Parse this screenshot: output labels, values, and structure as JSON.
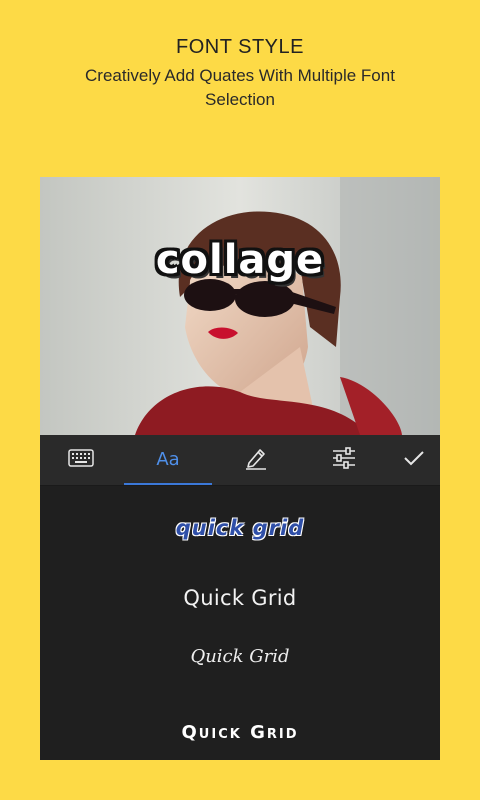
{
  "promo": {
    "title": "FONT STYLE",
    "subtitle": "Creatively Add Quates With Multiple Font Selection"
  },
  "photo": {
    "overlay_text": "collage"
  },
  "toolbar": {
    "font_tab_label": "Aa",
    "icons": [
      "keyboard-icon",
      "font-icon",
      "pencil-icon",
      "sliders-icon",
      "check-icon"
    ],
    "accent_color": "#3b78d8"
  },
  "font_options": [
    {
      "text": "quick grid"
    },
    {
      "text": "Quick Grid"
    },
    {
      "text": "Quick Grid"
    },
    {
      "text": "Quick Grid"
    }
  ],
  "colors": {
    "background": "#FDDA46",
    "panel": "#1f1f1f"
  }
}
